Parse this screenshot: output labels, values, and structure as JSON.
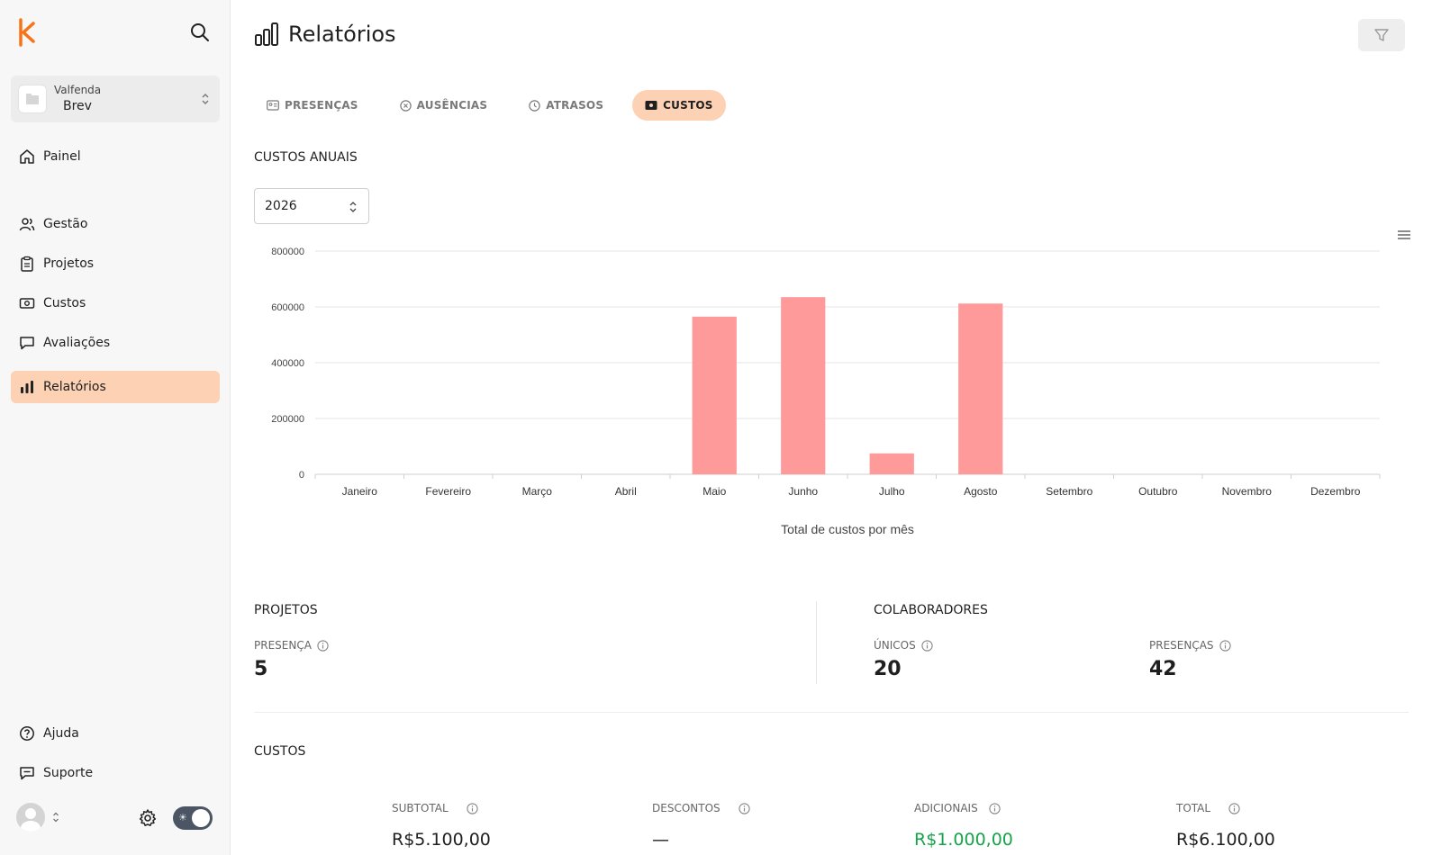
{
  "sidebar": {
    "organization": {
      "label": "Valfenda",
      "name": "Brev"
    },
    "items": [
      {
        "label": "Painel",
        "icon": "home-icon"
      },
      {
        "label": "Gestão",
        "icon": "users-icon"
      },
      {
        "label": "Projetos",
        "icon": "clipboard-icon"
      },
      {
        "label": "Custos",
        "icon": "money-icon"
      },
      {
        "label": "Avaliações",
        "icon": "chat-icon"
      },
      {
        "label": "Relatórios",
        "icon": "bar-chart-icon",
        "active": true
      }
    ],
    "footer_items": [
      {
        "label": "Ajuda",
        "icon": "help-icon"
      },
      {
        "label": "Suporte",
        "icon": "support-icon"
      }
    ]
  },
  "header": {
    "title": "Relatórios"
  },
  "tabs": [
    {
      "label": "PRESENÇAS"
    },
    {
      "label": "AUSÊNCIAS"
    },
    {
      "label": "ATRASOS"
    },
    {
      "label": "CUSTOS",
      "active": true
    }
  ],
  "annual": {
    "section_title": "CUSTOS ANUAIS",
    "year": "2026"
  },
  "chart_data": {
    "type": "bar",
    "categories": [
      "Janeiro",
      "Fevereiro",
      "Março",
      "Abril",
      "Maio",
      "Junho",
      "Julho",
      "Agosto",
      "Setembro",
      "Outubro",
      "Novembro",
      "Dezembro"
    ],
    "values": [
      0,
      0,
      0,
      0,
      565000,
      635000,
      75000,
      612000,
      0,
      0,
      0,
      0
    ],
    "title": "",
    "xlabel": "Total de custos por mês",
    "ylabel": "",
    "ylim": [
      0,
      800000
    ],
    "yticks": [
      "0",
      "200000",
      "400000",
      "600000",
      "800000"
    ],
    "grid": true,
    "bar_color": "#ff9a9a"
  },
  "projects": {
    "title": "PROJETOS",
    "presence_label": "PRESENÇA",
    "presence_value": "5"
  },
  "collaborators": {
    "title": "COLABORADORES",
    "unique_label": "ÚNICOS",
    "unique_value": "20",
    "presences_label": "PRESENÇAS",
    "presences_value": "42"
  },
  "costs": {
    "title": "CUSTOS",
    "subtotal_label": "SUBTOTAL",
    "subtotal_value": "R$5.100,00",
    "discounts_label": "DESCONTOS",
    "discounts_value": "—",
    "additional_label": "ADICIONAIS",
    "additional_value": "R$1.000,00",
    "total_label": "TOTAL",
    "total_value": "R$6.100,00"
  },
  "colors": {
    "accent": "#f97316",
    "active_bg": "#fdd1b3",
    "positive": "#16a34a"
  }
}
